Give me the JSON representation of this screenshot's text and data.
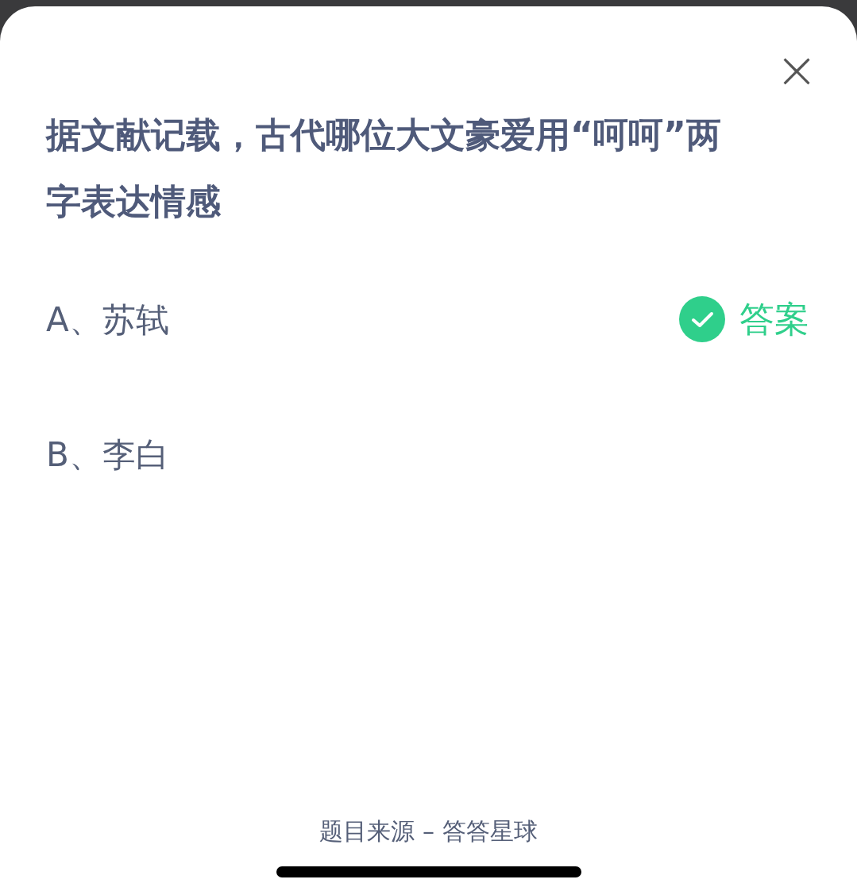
{
  "close": {
    "symbol": "×"
  },
  "question": "据文献记载，古代哪位大文豪爱用“呵呵”两字表达情感",
  "options": [
    {
      "label": "A、苏轼",
      "correct": true
    },
    {
      "label": "B、李白",
      "correct": false
    }
  ],
  "answer_label": "答案",
  "footer": "题目来源 – 答答星球"
}
